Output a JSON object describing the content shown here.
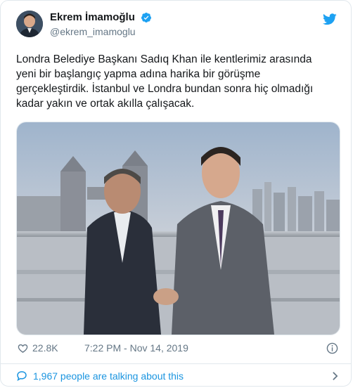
{
  "tweet": {
    "author_name": "Ekrem İmamoğlu",
    "author_handle": "@ekrem_imamoglu",
    "text": "Londra Belediye Başkanı Sadıq Khan ile kentlerimiz arasında\nyeni bir başlangıç yapma adına harika bir görüşme\ngerçekleştirdik. İstanbul ve Londra bundan sonra hiç olmadığı\nkadar yakın ve ortak akılla çalışacak.",
    "likes": "22.8K",
    "timestamp": "7:22 PM - Nov 14, 2019",
    "talking": "1,967 people are talking about this"
  },
  "icons": {
    "verified": "verified-badge-icon",
    "brand": "twitter-bird-icon",
    "like": "heart-icon",
    "info": "info-icon",
    "reply": "speech-bubble-icon",
    "more": "chevron-right-icon"
  },
  "colors": {
    "brand": "#1da1f2",
    "link": "#1b95e0",
    "secondary_text": "#657786",
    "border": "#e1e8ed"
  }
}
